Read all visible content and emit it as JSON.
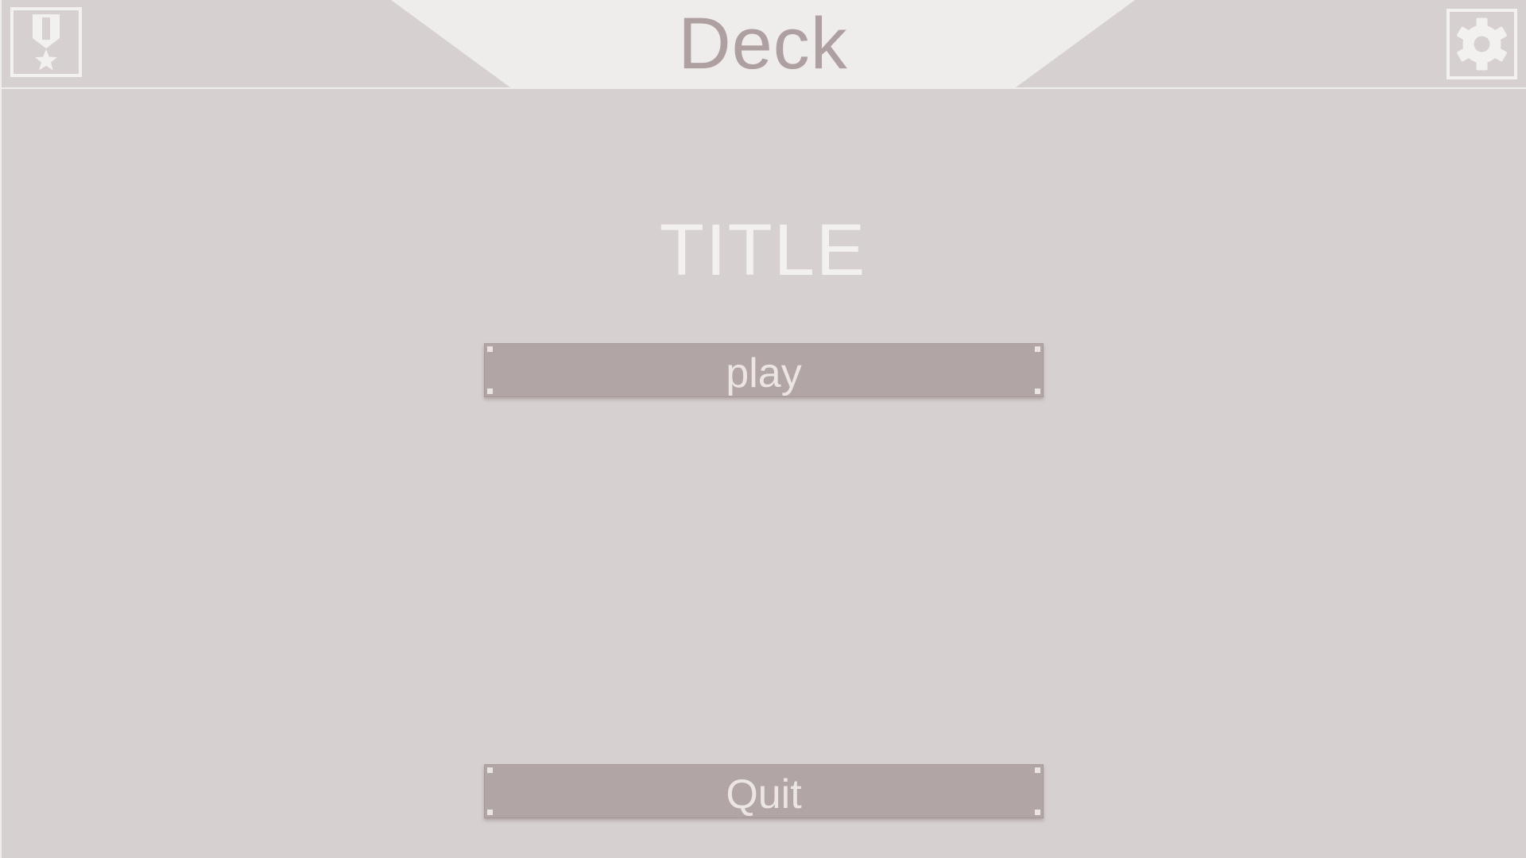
{
  "header": {
    "title": "Deck",
    "left_icon": "medal-icon",
    "right_icon": "gear-icon"
  },
  "main": {
    "title": "TITLE",
    "play_label": "play",
    "quit_label": "Quit"
  },
  "colors": {
    "background": "#d7d0d0",
    "banner": "#efedeb",
    "accent_text": "#ae9fa1",
    "button": "#b1a5a5",
    "light": "#f3f1ef"
  }
}
